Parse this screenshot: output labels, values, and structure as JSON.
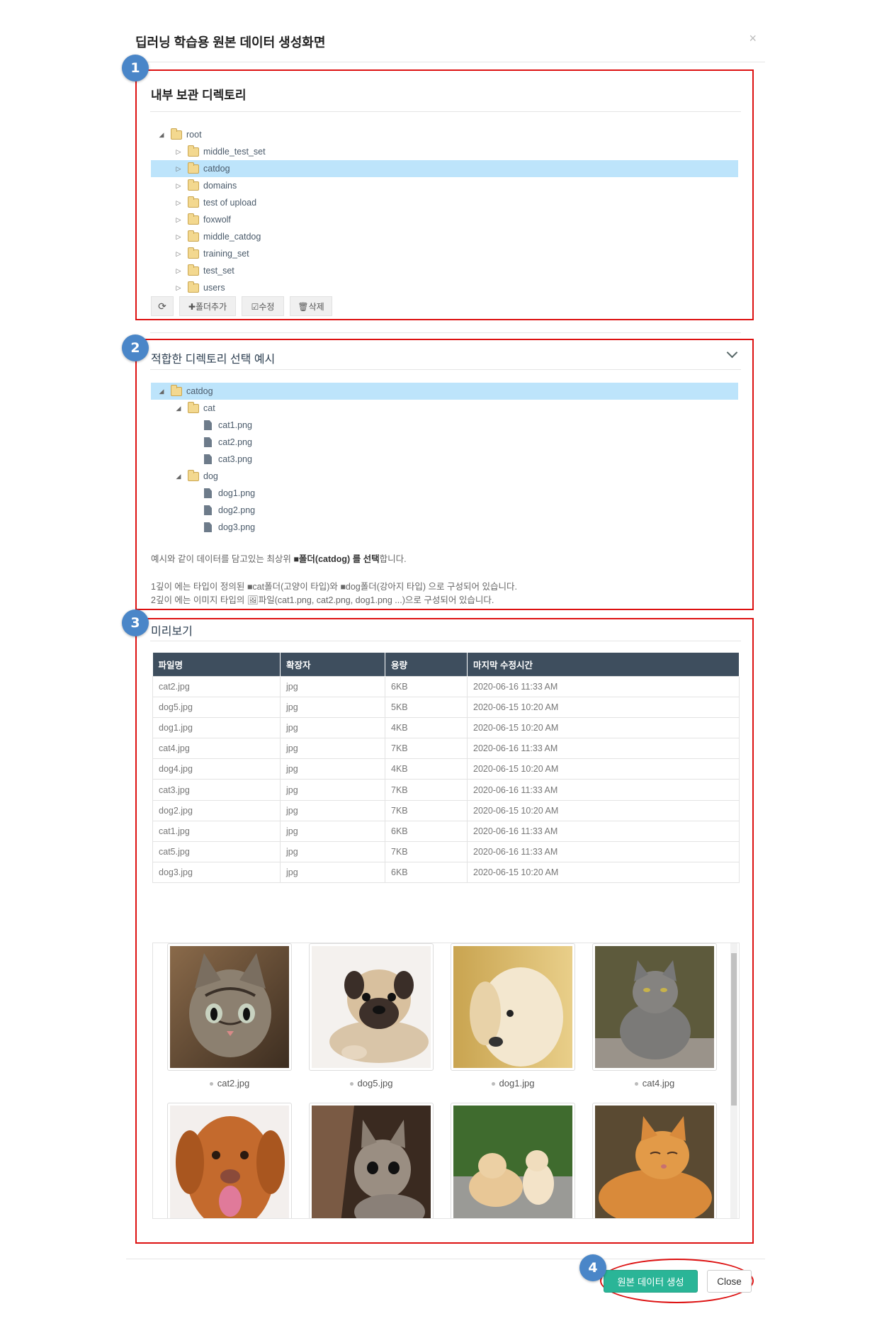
{
  "modal": {
    "title": "딥러닝 학습용 원본 데이터 생성화면",
    "close_glyph": "×"
  },
  "badges": [
    "1",
    "2",
    "3",
    "4"
  ],
  "section1": {
    "title": "내부 보관 디렉토리",
    "root": "root",
    "folders": [
      "middle_test_set",
      "catdog",
      "domains",
      "test of upload",
      "foxwolf",
      "middle_catdog",
      "training_set",
      "test_set",
      "users"
    ],
    "selected": "catdog",
    "toolbar": {
      "refresh_glyph": "⟳",
      "add_folder": "✚폴더추가",
      "edit": "☑수정",
      "delete": "🗑삭제"
    }
  },
  "section2": {
    "title": "적합한 디렉토리 선택 예시",
    "tree": {
      "root": "catdog",
      "cat": "cat",
      "cat_files": [
        "cat1.png",
        "cat2.png",
        "cat3.png"
      ],
      "dog": "dog",
      "dog_files": [
        "dog1.png",
        "dog2.png",
        "dog3.png"
      ]
    },
    "note1_a": "예시와 같이 데이터를 담고있는 최상위 ",
    "note1_b": "■폴더(catdog) 를 선택",
    "note1_c": "합니다.",
    "note2": "1깊이 에는 타입이 정의된 ■cat폴더(고양이 타입)와 ■dog폴더(강아지 타입) 으로 구성되어 있습니다.",
    "note3": "2깊이 에는 이미지 타입의 🖼파일(cat1.png, cat2.png, dog1.png ...)으로 구성되어 있습니다."
  },
  "section3": {
    "title": "미리보기",
    "columns": [
      "파일명",
      "확장자",
      "용량",
      "마지막 수정시간"
    ],
    "rows": [
      [
        "cat2.jpg",
        "jpg",
        "6KB",
        "2020-06-16 11:33 AM"
      ],
      [
        "dog5.jpg",
        "jpg",
        "5KB",
        "2020-06-15 10:20 AM"
      ],
      [
        "dog1.jpg",
        "jpg",
        "4KB",
        "2020-06-15 10:20 AM"
      ],
      [
        "cat4.jpg",
        "jpg",
        "7KB",
        "2020-06-16 11:33 AM"
      ],
      [
        "dog4.jpg",
        "jpg",
        "4KB",
        "2020-06-15 10:20 AM"
      ],
      [
        "cat3.jpg",
        "jpg",
        "7KB",
        "2020-06-16 11:33 AM"
      ],
      [
        "dog2.jpg",
        "jpg",
        "7KB",
        "2020-06-15 10:20 AM"
      ],
      [
        "cat1.jpg",
        "jpg",
        "6KB",
        "2020-06-16 11:33 AM"
      ],
      [
        "cat5.jpg",
        "jpg",
        "7KB",
        "2020-06-16 11:33 AM"
      ],
      [
        "dog3.jpg",
        "jpg",
        "6KB",
        "2020-06-15 10:20 AM"
      ]
    ],
    "gallery": [
      "cat2.jpg",
      "dog5.jpg",
      "dog1.jpg",
      "cat4.jpg"
    ]
  },
  "footer": {
    "create_label": "원본 데이터 생성",
    "close_label": "Close"
  },
  "colors": {
    "highlight": "#bde4fb",
    "red_box": "#dd1111",
    "badge": "#4a86c8",
    "table_header": "#3e4e5e",
    "create_button": "#2ab597"
  }
}
